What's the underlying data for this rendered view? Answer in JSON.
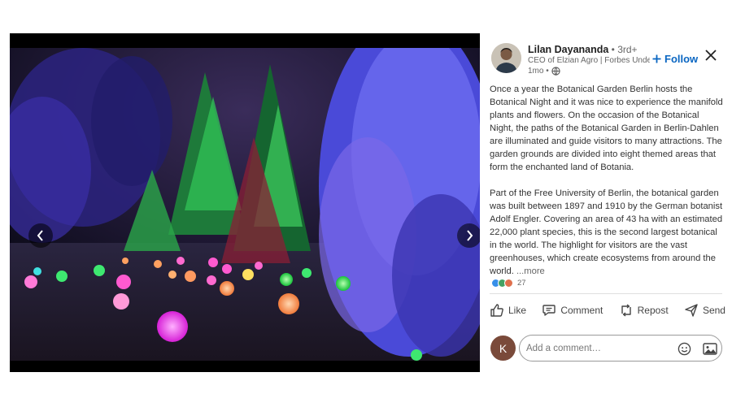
{
  "author": {
    "name": "Lilan Dayananda",
    "degree": " • 3rd+",
    "headline": "CEO of Elzian Agro | Forbes Unde...",
    "time": "1mo •"
  },
  "follow_label": "Follow",
  "post": {
    "paragraph1": "Once a year the Botanical Garden Berlin hosts the Botanical Night and it was nice to experience the manifold plants and flowers. On the occasion of the Botanical Night, the paths of the Botanical Garden in Berlin-Dahlen are illuminated and guide visitors to many attractions. The garden grounds are divided into eight themed areas that form the enchanted land of Botania.",
    "paragraph2": "Part of the Free University of Berlin, the botanical garden was built between 1897 and 1910 by the German botanist Adolf Engler. Covering an area of 43 ha with an estimated 22,000 plant species, this is the second largest botanical in the world. The highlight for visitors are the vast greenhouses, which create ecosystems from around the world. ",
    "more": "...more"
  },
  "reactions": {
    "count": "27"
  },
  "actions": {
    "like": "Like",
    "comment": "Comment",
    "repost": "Repost",
    "send": "Send"
  },
  "commenter_initial": "K",
  "comment_input": {
    "placeholder": "Add a comment…"
  },
  "colors": {
    "accent": "#0a66c2",
    "like_blue": "#378fe9",
    "celebrate_green": "#44a264",
    "love_red": "#df704d"
  },
  "icons": [
    "chevron-left-icon",
    "chevron-right-icon",
    "plus-icon",
    "close-icon",
    "globe-icon",
    "like-icon",
    "comment-icon",
    "repost-icon",
    "send-icon",
    "emoji-icon",
    "image-icon"
  ]
}
